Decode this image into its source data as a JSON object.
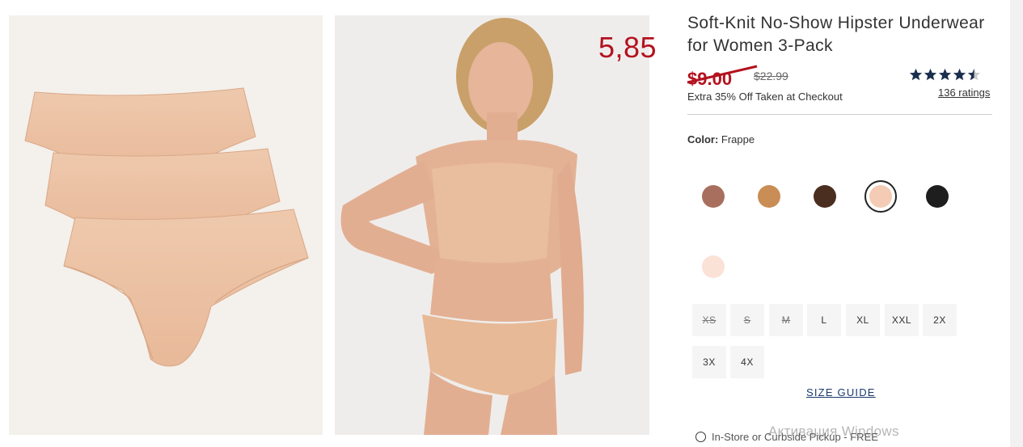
{
  "annotation": {
    "price_note": "5,85"
  },
  "product": {
    "title": "Soft-Knit No-Show Hipster Underwear for Women 3-Pack",
    "sale_price": "$9.00",
    "original_price": "$22.99",
    "promo": "Extra 35% Off Taken at Checkout",
    "rating": 4.5,
    "ratings_label": "136 ratings"
  },
  "color": {
    "label": "Color:",
    "selected": "Frappe",
    "swatches": [
      {
        "name": "swatch-mauve",
        "hex": "#a86f5f"
      },
      {
        "name": "swatch-caramel",
        "hex": "#c98d55"
      },
      {
        "name": "swatch-espresso",
        "hex": "#4a2e1f"
      },
      {
        "name": "swatch-frappe",
        "hex": "#f4cbb4"
      },
      {
        "name": "swatch-black",
        "hex": "#1e1e1e"
      },
      {
        "name": "swatch-blush",
        "hex": "#fbe2d6"
      }
    ]
  },
  "sizes": [
    {
      "label": "XS",
      "available": false
    },
    {
      "label": "S",
      "available": false
    },
    {
      "label": "M",
      "available": false
    },
    {
      "label": "L",
      "available": true
    },
    {
      "label": "XL",
      "available": true
    },
    {
      "label": "XXL",
      "available": true
    },
    {
      "label": "2X",
      "available": true
    },
    {
      "label": "3X",
      "available": true
    },
    {
      "label": "4X",
      "available": true
    }
  ],
  "size_guide": "SIZE GUIDE",
  "pickup": "In-Store or Curbside Pickup - FREE",
  "watermark": "Активация Windows",
  "colors": {
    "sale_red": "#b3121f",
    "star_navy": "#1a2f4d",
    "link_navy": "#1a3a6e"
  }
}
